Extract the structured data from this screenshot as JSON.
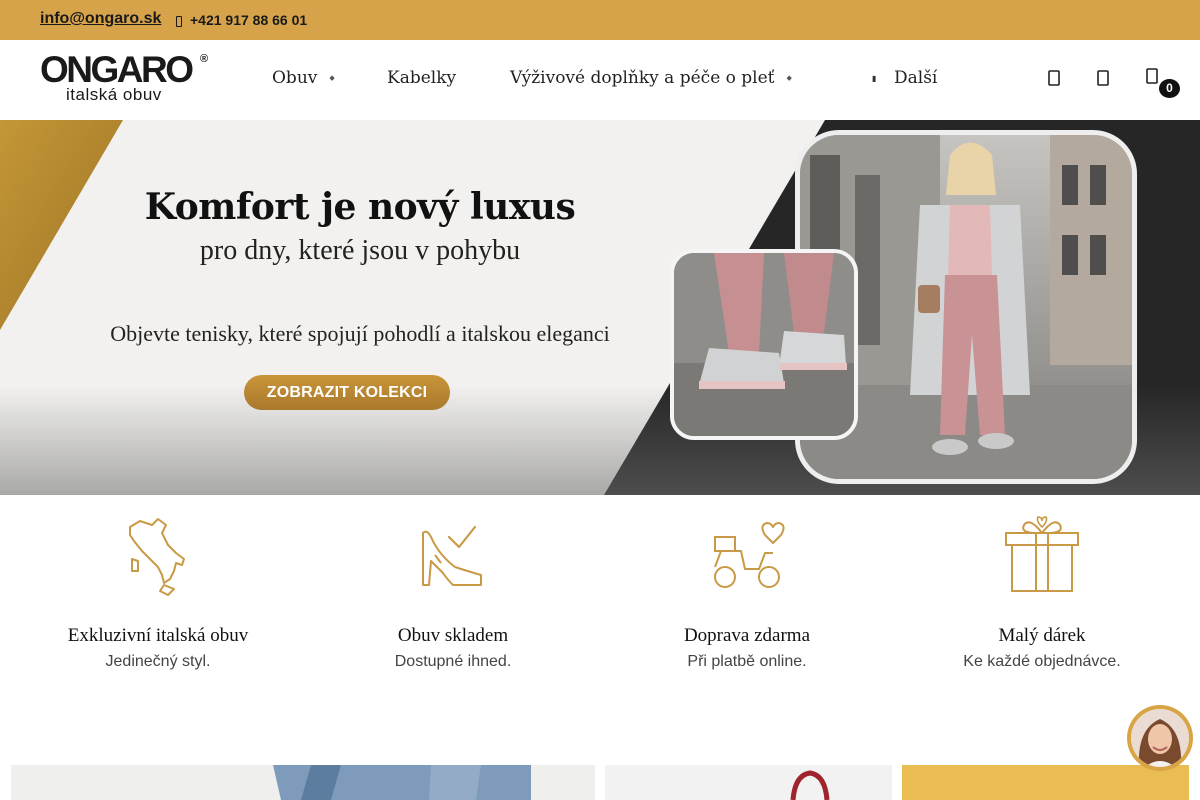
{
  "topbar": {
    "email": "info@ongaro.sk",
    "phone": "+421 917 88 66 01"
  },
  "header": {
    "logo_brand": "ONGARO",
    "logo_reg": "®",
    "logo_tagline": "italská obuv",
    "nav": [
      {
        "label": "Obuv",
        "has_dropdown": true
      },
      {
        "label": "Kabelky",
        "has_dropdown": false
      },
      {
        "label": "Výživové doplňky a péče o pleť",
        "has_dropdown": true
      }
    ],
    "more_label": "Další",
    "cart_count": "0"
  },
  "hero": {
    "title": "Komfort je nový luxus",
    "subtitle": "pro dny, které jsou v pohybu",
    "description": "Objevte tenisky, které spojují pohodlí a italskou eleganci",
    "button_label": "ZOBRAZIT KOLEKCI"
  },
  "features": [
    {
      "icon": "italy-map-icon",
      "title": "Exkluzivní italská obuv",
      "subtitle": "Jedinečný styl."
    },
    {
      "icon": "high-heel-check-icon",
      "title": "Obuv skladem",
      "subtitle": "Dostupné ihned."
    },
    {
      "icon": "delivery-scooter-icon",
      "title": "Doprava zdarma",
      "subtitle": "Při platbě online."
    },
    {
      "icon": "gift-box-icon",
      "title": "Malý dárek",
      "subtitle": "Ke každé objednávce."
    }
  ],
  "colors": {
    "accent_gold": "#d6a34a",
    "hero_bg": "#f2f1ef",
    "dark_triangle": "#262626",
    "button_gold": "#b88632",
    "icon_gold": "#c99a45",
    "tile_yellow": "#e9bd52"
  }
}
